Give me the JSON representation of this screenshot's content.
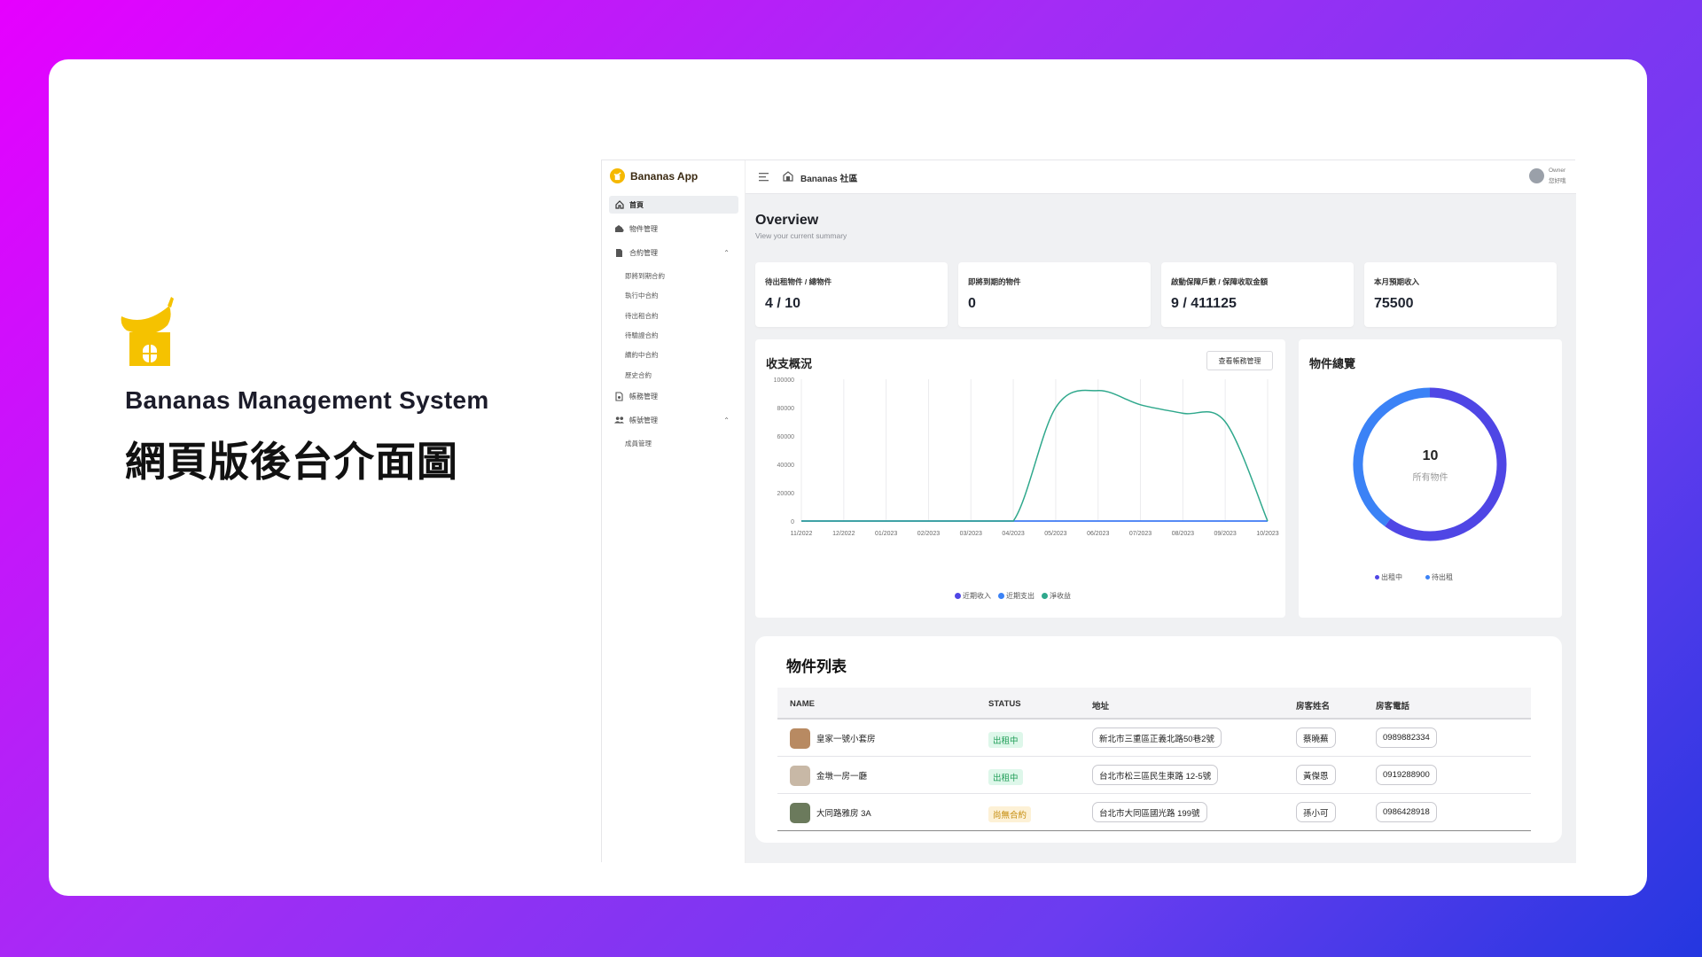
{
  "slide": {
    "title": "Bananas Management System",
    "subtitle": "網頁版後台介面圖"
  },
  "app": {
    "name": "Bananas App",
    "community": "Bananas 社區",
    "user": {
      "role": "Owner",
      "name": "您好哦"
    }
  },
  "sidebar": {
    "items": [
      {
        "label": "首頁",
        "icon": "home-icon",
        "active": true
      },
      {
        "label": "物件管理",
        "icon": "property-icon"
      },
      {
        "label": "合約管理",
        "icon": "contract-icon",
        "expanded": true
      },
      {
        "label": "帳務管理",
        "icon": "ledger-icon"
      },
      {
        "label": "帳號管理",
        "icon": "users-icon",
        "expanded": true
      }
    ],
    "contract_subitems": [
      "即將到期合約",
      "執行中合約",
      "待出租合約",
      "待驗證合約",
      "續約中合約",
      "歷史合約"
    ],
    "account_subitems": [
      "成員管理"
    ]
  },
  "overview": {
    "title": "Overview",
    "subtitle": "View your current summary"
  },
  "stats": [
    {
      "label": "待出租物件 / 總物件",
      "value": "4 / 10"
    },
    {
      "label": "即將到期的物件",
      "value": "0"
    },
    {
      "label": "啟動保障戶數 / 保障收取金額",
      "value": "9 / 411125"
    },
    {
      "label": "本月預期收入",
      "value": "75500"
    }
  ],
  "income_panel": {
    "title": "收支概況",
    "button_label": "查看帳務管理"
  },
  "property_panel": {
    "title": "物件總覽",
    "total": "10",
    "total_label": "所有物件"
  },
  "chart_data": [
    {
      "type": "line",
      "x": [
        "11/2022",
        "12/2022",
        "01/2023",
        "02/2023",
        "03/2023",
        "04/2023",
        "05/2023",
        "06/2023",
        "07/2023",
        "08/2023",
        "09/2023",
        "10/2023"
      ],
      "ylim": [
        0,
        100000
      ],
      "yticks": [
        "100000",
        "80000",
        "60000",
        "40000",
        "20000",
        "0"
      ],
      "series": [
        {
          "name": "近期收入",
          "color": "#4f46e5",
          "values": [
            0,
            0,
            0,
            0,
            0,
            0,
            0,
            0,
            0,
            0,
            0,
            0
          ]
        },
        {
          "name": "近期支出",
          "color": "#3b82f6",
          "values": [
            0,
            0,
            0,
            0,
            0,
            0,
            0,
            0,
            0,
            0,
            0,
            0
          ]
        },
        {
          "name": "淨收益",
          "color": "#2fa88c",
          "values": [
            0,
            0,
            0,
            0,
            0,
            0,
            80000,
            92000,
            82000,
            76000,
            70000,
            0
          ]
        }
      ],
      "grid": true,
      "legend": "bottom"
    },
    {
      "type": "pie",
      "labels": [
        "出租中",
        "待出租"
      ],
      "values": [
        6,
        4
      ],
      "colors": [
        "#4f46e5",
        "#3b82f6"
      ],
      "legend": "bottom"
    }
  ],
  "property_list": {
    "title": "物件列表",
    "columns": [
      "NAME",
      "STATUS",
      "地址",
      "房客姓名",
      "房客電話"
    ],
    "rows": [
      {
        "name": "皇家一號小套房",
        "status": "出租中",
        "status_type": "rented",
        "address": "新北市三重區正義北路50巷2號",
        "tenant": "蔡曉蕪",
        "phone": "0989882334",
        "thumb_color": "#b88a62"
      },
      {
        "name": "金墩一房一廳",
        "status": "出租中",
        "status_type": "rented",
        "address": "台北市松三區民生東路 12-5號",
        "tenant": "黃傑恩",
        "phone": "0919288900",
        "thumb_color": "#c8b8a6"
      },
      {
        "name": "大同路雅房 3A",
        "status": "尚無合約",
        "status_type": "none",
        "address": "台北市大同區國光路 199號",
        "tenant": "孫小可",
        "phone": "0986428918",
        "thumb_color": "#6b7a5c"
      }
    ]
  }
}
